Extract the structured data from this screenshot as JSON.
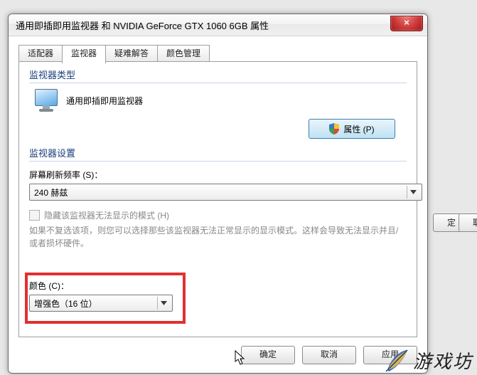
{
  "dialog": {
    "title": "通用即插即用监视器 和 NVIDIA GeForce GTX 1060 6GB 属性",
    "close_glyph": "×"
  },
  "tabs": {
    "adapter": "适配器",
    "monitor": "监视器",
    "troubleshoot": "疑难解答",
    "color": "颜色管理"
  },
  "monitor_type": {
    "group_title": "监视器类型",
    "name": "通用即插即用监视器",
    "properties_button": "属性 (P)"
  },
  "monitor_settings": {
    "group_title": "监视器设置",
    "refresh_label": "屏幕刷新频率 (S)：",
    "refresh_value": "240 赫兹",
    "hide_modes_label": "隐藏该监视器无法显示的模式 (H)",
    "hide_modes_hint": "如果不复选该项，则您可以选择那些该监视器无法正常显示的显示模式。这样会导致无法显示并且/或者损坏硬件。"
  },
  "color_section": {
    "label": "颜色 (C)：",
    "value": "增强色（16 位）"
  },
  "buttons": {
    "ok": "确定",
    "cancel": "取消",
    "apply": "应用"
  },
  "background_buttons": {
    "set": "定",
    "cancel": "取"
  },
  "watermark": {
    "text": "游戏坊"
  }
}
